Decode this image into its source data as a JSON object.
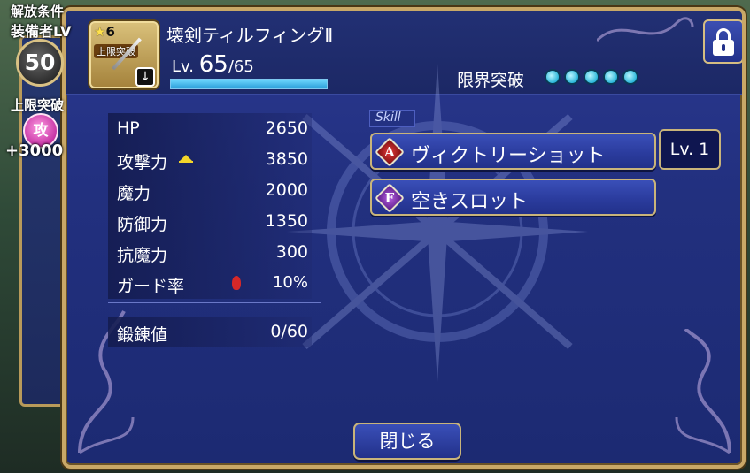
{
  "unlock": {
    "title": "解放条件",
    "subtitle": "装備者LV",
    "level": "50"
  },
  "limit_break_side": {
    "title": "上限突破",
    "stat_label": "攻",
    "bonus": "+3000"
  },
  "weapon": {
    "rarity": "6",
    "limit_tag": "上限突破",
    "type_icon": "dagger-icon",
    "name": "壊剣ティルフィングⅡ",
    "level_prefix": "Lv.",
    "level_current": "65",
    "level_max": "/65",
    "exp_fraction": 1.0
  },
  "limit_break": {
    "label": "限界突破",
    "dots_filled": 5,
    "dots_total": 5
  },
  "stats": [
    {
      "name": "HP",
      "value": "2650"
    },
    {
      "name": "攻撃力",
      "value": "3850",
      "icon": "up-arrow-icon"
    },
    {
      "name": "魔力",
      "value": "2000"
    },
    {
      "name": "防御力",
      "value": "1350"
    },
    {
      "name": "抗魔力",
      "value": "300"
    },
    {
      "name": "ガード率",
      "value": "10%",
      "icon": "flame-icon"
    }
  ],
  "tempering": {
    "name": "鍛錬値",
    "value": "0/60"
  },
  "skill": {
    "tag": "Skill",
    "slots": [
      {
        "badge": "A",
        "name": "ヴィクトリーショット"
      },
      {
        "badge": "F",
        "name": "空きスロット"
      }
    ],
    "level": "Lv. 1"
  },
  "close_label": "閉じる",
  "colors": {
    "panel": "#22307f",
    "gold_border": "#c9a867",
    "limit_dot": "#2ab6d9",
    "attack_badge": "#c22ca0"
  }
}
